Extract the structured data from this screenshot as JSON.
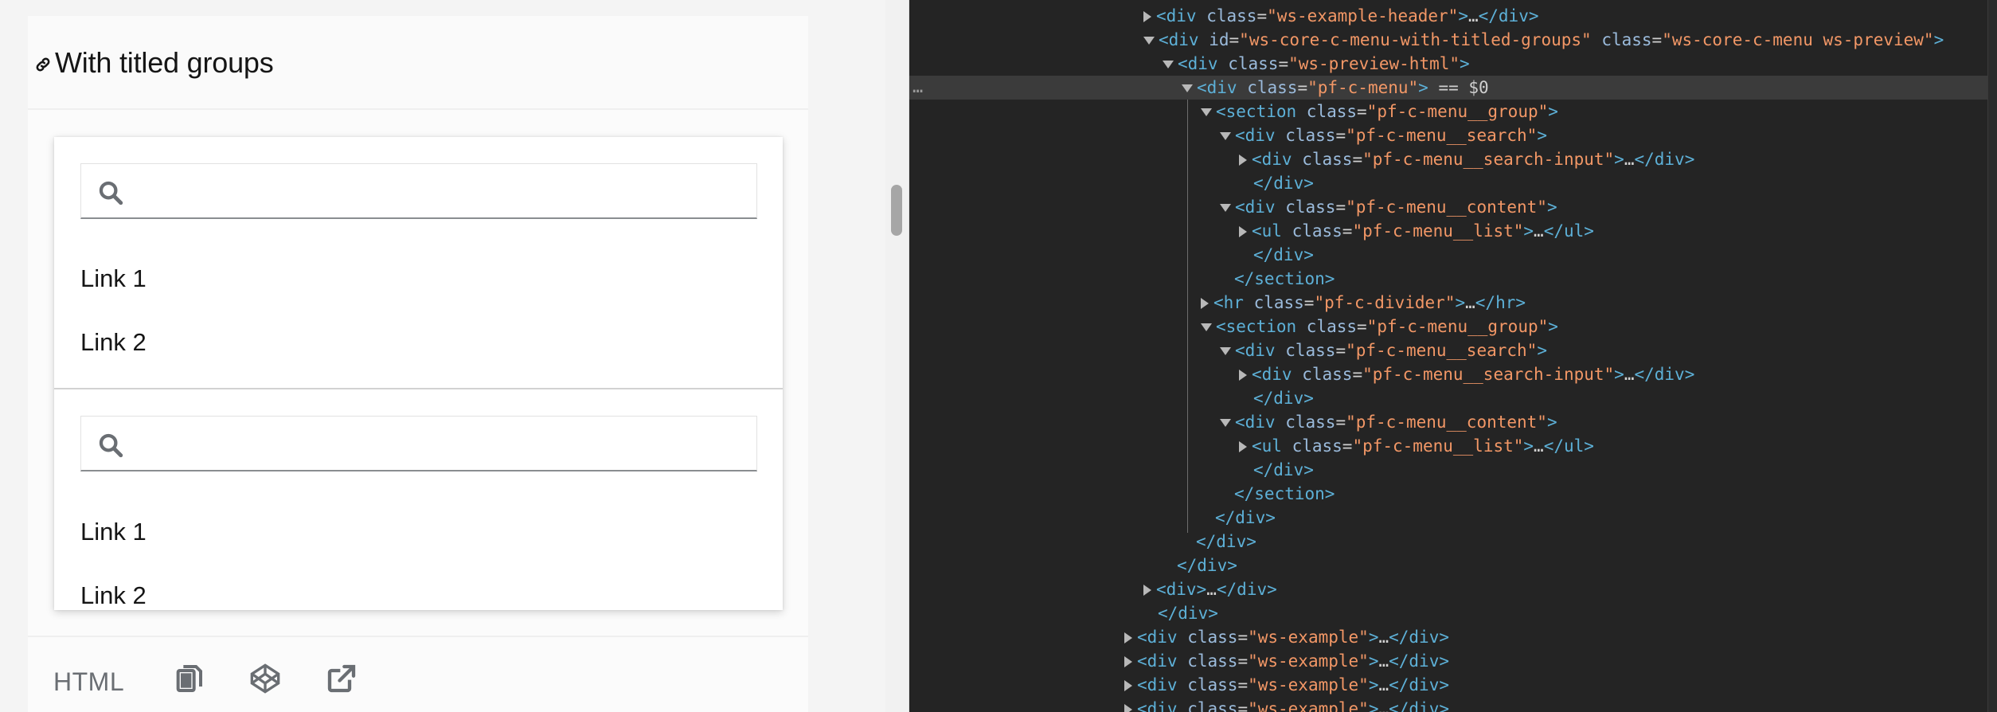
{
  "example": {
    "title": "With titled groups",
    "groups": [
      {
        "search_placeholder": "",
        "links": [
          "Link 1",
          "Link 2"
        ]
      },
      {
        "search_placeholder": "",
        "links": [
          "Link 1",
          "Link 2"
        ]
      }
    ],
    "toolbar": {
      "html_tab": "HTML"
    }
  },
  "devtools": {
    "selected_suffix": " == $0",
    "dots": "…",
    "lines": [
      {
        "indent": 12,
        "tri": "closed",
        "tag": "div",
        "attrs": [
          [
            "class",
            "ws-example-header"
          ]
        ],
        "collapsed": true,
        "close": "div"
      },
      {
        "indent": 12,
        "tri": "open",
        "tag": "div",
        "attrs": [
          [
            "id",
            "ws-core-c-menu-with-titled-groups"
          ],
          [
            "class",
            "ws-core-c-menu ws-preview"
          ]
        ]
      },
      {
        "indent": 13,
        "tri": "open",
        "tag": "div",
        "attrs": [
          [
            "class",
            "ws-preview-html"
          ]
        ]
      },
      {
        "indent": 14,
        "tri": "open",
        "tag": "div",
        "attrs": [
          [
            "class",
            "pf-c-menu"
          ]
        ],
        "selected": true
      },
      {
        "indent": 15,
        "tri": "open",
        "tag": "section",
        "attrs": [
          [
            "class",
            "pf-c-menu__group"
          ]
        ]
      },
      {
        "indent": 16,
        "tri": "open",
        "tag": "div",
        "attrs": [
          [
            "class",
            "pf-c-menu__search"
          ]
        ]
      },
      {
        "indent": 17,
        "tri": "closed",
        "tag": "div",
        "attrs": [
          [
            "class",
            "pf-c-menu__search-input"
          ]
        ],
        "collapsed": true,
        "close": "div"
      },
      {
        "indent": 17,
        "tri": "none",
        "closing": "div"
      },
      {
        "indent": 16,
        "tri": "open",
        "tag": "div",
        "attrs": [
          [
            "class",
            "pf-c-menu__content"
          ]
        ]
      },
      {
        "indent": 17,
        "tri": "closed",
        "tag": "ul",
        "attrs": [
          [
            "class",
            "pf-c-menu__list"
          ]
        ],
        "collapsed": true,
        "close": "ul"
      },
      {
        "indent": 17,
        "tri": "none",
        "closing": "div"
      },
      {
        "indent": 16,
        "tri": "none",
        "closing": "section"
      },
      {
        "indent": 15,
        "tri": "closed",
        "tag": "hr",
        "attrs": [
          [
            "class",
            "pf-c-divider"
          ]
        ],
        "collapsed": true,
        "close": "hr"
      },
      {
        "indent": 15,
        "tri": "open",
        "tag": "section",
        "attrs": [
          [
            "class",
            "pf-c-menu__group"
          ]
        ]
      },
      {
        "indent": 16,
        "tri": "open",
        "tag": "div",
        "attrs": [
          [
            "class",
            "pf-c-menu__search"
          ]
        ]
      },
      {
        "indent": 17,
        "tri": "closed",
        "tag": "div",
        "attrs": [
          [
            "class",
            "pf-c-menu__search-input"
          ]
        ],
        "collapsed": true,
        "close": "div"
      },
      {
        "indent": 17,
        "tri": "none",
        "closing": "div"
      },
      {
        "indent": 16,
        "tri": "open",
        "tag": "div",
        "attrs": [
          [
            "class",
            "pf-c-menu__content"
          ]
        ]
      },
      {
        "indent": 17,
        "tri": "closed",
        "tag": "ul",
        "attrs": [
          [
            "class",
            "pf-c-menu__list"
          ]
        ],
        "collapsed": true,
        "close": "ul"
      },
      {
        "indent": 17,
        "tri": "none",
        "closing": "div"
      },
      {
        "indent": 16,
        "tri": "none",
        "closing": "section"
      },
      {
        "indent": 15,
        "tri": "none",
        "closing": "div"
      },
      {
        "indent": 14,
        "tri": "none",
        "closing": "div"
      },
      {
        "indent": 13,
        "tri": "none",
        "closing": "div"
      },
      {
        "indent": 12,
        "tri": "closed",
        "tag": "div",
        "attrs": [],
        "collapsed": true,
        "close": "div"
      },
      {
        "indent": 12,
        "tri": "none",
        "closing": "div"
      },
      {
        "indent": 11,
        "tri": "closed",
        "tag": "div",
        "attrs": [
          [
            "class",
            "ws-example"
          ]
        ],
        "collapsed": true,
        "close": "div"
      },
      {
        "indent": 11,
        "tri": "closed",
        "tag": "div",
        "attrs": [
          [
            "class",
            "ws-example"
          ]
        ],
        "collapsed": true,
        "close": "div"
      },
      {
        "indent": 11,
        "tri": "closed",
        "tag": "div",
        "attrs": [
          [
            "class",
            "ws-example"
          ]
        ],
        "collapsed": true,
        "close": "div"
      },
      {
        "indent": 11,
        "tri": "closed",
        "tag": "div",
        "attrs": [
          [
            "class",
            "ws-example"
          ]
        ],
        "collapsed": true,
        "close": "div"
      }
    ]
  }
}
